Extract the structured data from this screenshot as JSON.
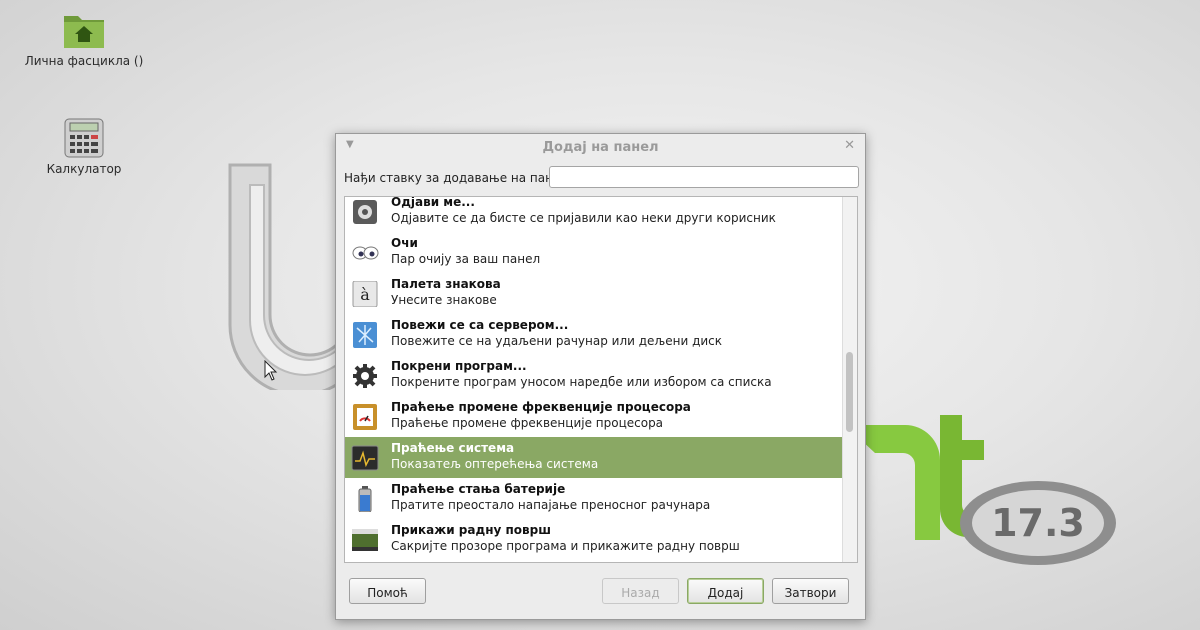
{
  "desktop": {
    "icons": [
      {
        "label": "Лична фасцикла ()",
        "icon": "home-folder-icon"
      },
      {
        "label": "Калкулатор",
        "icon": "calculator-icon"
      }
    ],
    "badge_text": "17.3"
  },
  "dialog": {
    "title": "Додај на панел",
    "search_label": "Нађи ставку за додавање на панел:",
    "search_value": "",
    "items": [
      {
        "name": "Одјави ме...",
        "desc": "Одјавите се да бисте се пријавили као неки други корисник",
        "icon": "logout-icon"
      },
      {
        "name": "Очи",
        "desc": "Пар очију за ваш панел",
        "icon": "eyes-icon"
      },
      {
        "name": "Палета знакова",
        "desc": "Унесите знакове",
        "icon": "character-palette-icon"
      },
      {
        "name": "Повежи се са сервером...",
        "desc": "Повежите се на удаљени рачунар или дељени диск",
        "icon": "network-server-icon"
      },
      {
        "name": "Покрени програм...",
        "desc": "Покрените програм уносом наредбе или избором са списка",
        "icon": "run-gear-icon"
      },
      {
        "name": "Праћење промене фреквенције процесора",
        "desc": "Праћење промене фреквенције процесора",
        "icon": "cpu-frequency-icon"
      },
      {
        "name": "Праћење система",
        "desc": "Показатељ оптерећења система",
        "icon": "system-monitor-icon",
        "selected": true
      },
      {
        "name": "Праћење стања батерије",
        "desc": "Пратите преостало напајање преносног рачунара",
        "icon": "battery-icon"
      },
      {
        "name": "Прикажи радну површ",
        "desc": "Сакријте прозоре програма и прикажите радну површ",
        "icon": "show-desktop-icon"
      }
    ],
    "buttons": {
      "help": "Помоћ",
      "back": "Назад",
      "add": "Додај",
      "close": "Затвори"
    }
  },
  "colors": {
    "selection": "#8aa864",
    "mint_green": "#87c940"
  }
}
